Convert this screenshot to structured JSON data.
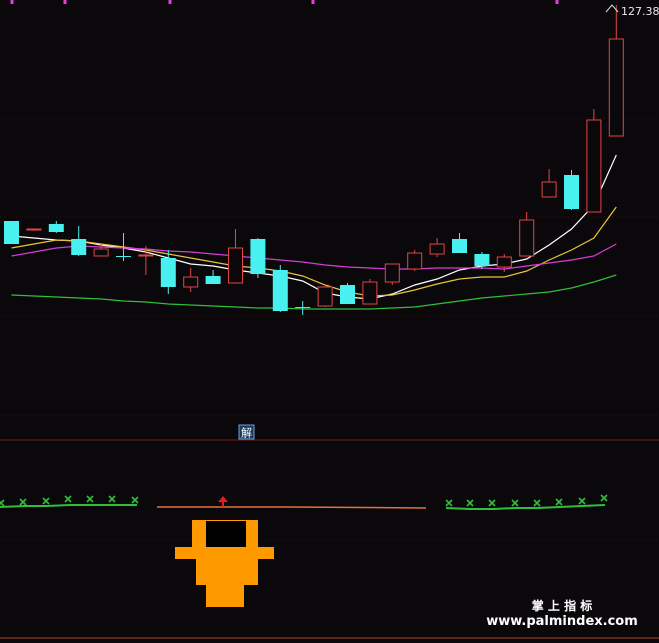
{
  "chart_data": {
    "type": "candlestick",
    "price_label": "127.38",
    "marker_label": "解",
    "candles": [
      {
        "o": 221.0,
        "h": 228.0,
        "l": 244.0,
        "c": 244.0
      },
      {
        "o": 230.0,
        "h": 229.0,
        "l": 231.0,
        "c": 229.0
      },
      {
        "o": 224.0,
        "h": 221.0,
        "l": 233.0,
        "c": 232.0
      },
      {
        "o": 239.0,
        "h": 226.0,
        "l": 256.0,
        "c": 255.0
      },
      {
        "o": 256.0,
        "h": 244.0,
        "l": 256.0,
        "c": 249.0
      },
      {
        "o": 256.0,
        "h": 233.0,
        "l": 261.0,
        "c": 256.0
      },
      {
        "o": 256.0,
        "h": 246.0,
        "l": 275.0,
        "c": 255.0
      },
      {
        "o": 258.0,
        "h": 250.0,
        "l": 294.0,
        "c": 287.0
      },
      {
        "o": 287.0,
        "h": 268.0,
        "l": 292.0,
        "c": 277.0
      },
      {
        "o": 276.0,
        "h": 270.0,
        "l": 284.0,
        "c": 284.0
      },
      {
        "o": 283.0,
        "h": 229.0,
        "l": 283.0,
        "c": 248.0
      },
      {
        "o": 239.0,
        "h": 238.0,
        "l": 278.0,
        "c": 274.0
      },
      {
        "o": 270.0,
        "h": 265.0,
        "l": 312.0,
        "c": 311.0
      },
      {
        "o": 307.0,
        "h": 301.0,
        "l": 315.0,
        "c": 307.0
      },
      {
        "o": 306.0,
        "h": 285.0,
        "l": 307.0,
        "c": 287.0
      },
      {
        "o": 285.0,
        "h": 283.0,
        "l": 304.0,
        "c": 304.0
      },
      {
        "o": 304.0,
        "h": 279.0,
        "l": 304.0,
        "c": 282.0
      },
      {
        "o": 282.0,
        "h": 264.0,
        "l": 285.0,
        "c": 264.0
      },
      {
        "o": 269.0,
        "h": 250.0,
        "l": 271.0,
        "c": 253.0
      },
      {
        "o": 254.0,
        "h": 238.0,
        "l": 257.0,
        "c": 244.0
      },
      {
        "o": 239.0,
        "h": 233.0,
        "l": 253.0,
        "c": 253.0
      },
      {
        "o": 254.0,
        "h": 252.0,
        "l": 269.0,
        "c": 266.0
      },
      {
        "o": 267.0,
        "h": 254.0,
        "l": 272.0,
        "c": 257.0
      },
      {
        "o": 256.0,
        "h": 212.0,
        "l": 256.0,
        "c": 220.0
      },
      {
        "o": 197.0,
        "h": 169.0,
        "l": 197.0,
        "c": 182.0
      },
      {
        "o": 175.0,
        "h": 170.0,
        "l": 210.0,
        "c": 209.0
      },
      {
        "o": 212.0,
        "h": 109.0,
        "l": 212.0,
        "c": 120.0
      },
      {
        "o": 136.0,
        "h": 5.0,
        "l": 136.0,
        "c": 39.0
      }
    ],
    "ma": [
      {
        "color": "#ffffff",
        "values": [
          236,
          238,
          240,
          241,
          245,
          248,
          252,
          258,
          264,
          266,
          270,
          273,
          276,
          281,
          293,
          297,
          299,
          294,
          285,
          279,
          270,
          266,
          264,
          259,
          245,
          229,
          205,
          155
        ]
      },
      {
        "color": "#e8c33a",
        "values": [
          248,
          244,
          240,
          241,
          244,
          247,
          250,
          254,
          258,
          262,
          266,
          268,
          271,
          276,
          285,
          292,
          296,
          295,
          290,
          284,
          279,
          277,
          277,
          271,
          260,
          250,
          238,
          207
        ]
      },
      {
        "color": "#d63dd6",
        "values": [
          256,
          252,
          248,
          246,
          247,
          248,
          249,
          251,
          252,
          254,
          256,
          258,
          260,
          262,
          265,
          267,
          268,
          269,
          269,
          268,
          268,
          268,
          269,
          266,
          263,
          260,
          256,
          244
        ]
      },
      {
        "color": "#2fbf3a",
        "values": [
          295,
          296,
          297,
          298,
          299,
          301,
          302,
          304,
          305,
          306,
          307,
          308,
          308,
          309,
          309,
          309,
          309,
          308,
          307,
          304,
          301,
          298,
          296,
          294,
          292,
          288,
          282,
          275
        ]
      }
    ],
    "top_markers": [
      12,
      65,
      170,
      313,
      557
    ],
    "signal": {
      "left_line_color": "#2fbf3a",
      "mid_line_color": "#e5703a",
      "x_color": "#2fbf3a",
      "arrow_color": "#e31c1c",
      "block_color": "#ff9900"
    }
  },
  "watermark": {
    "line1": "掌 上 指 标",
    "line2": "www.palmindex.com"
  }
}
